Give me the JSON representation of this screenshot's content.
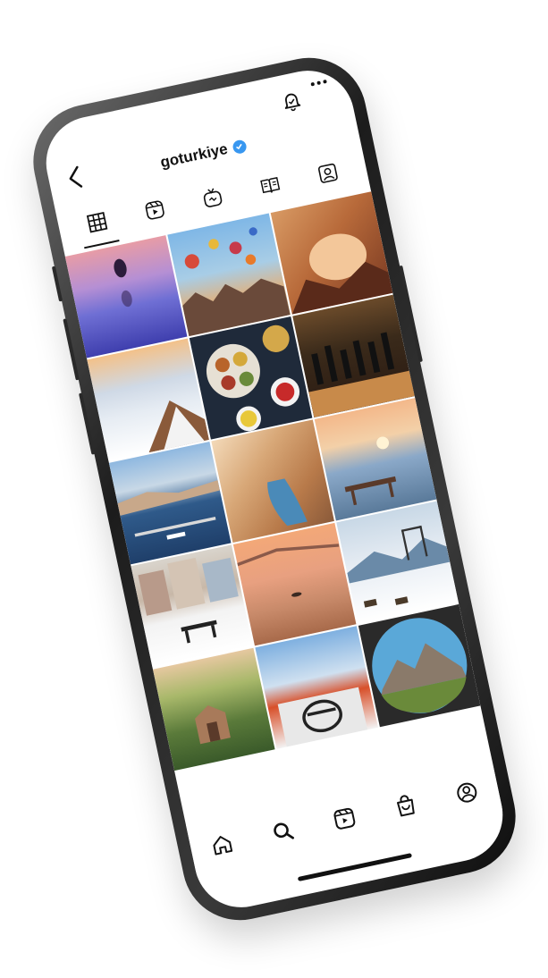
{
  "app": {
    "username": "goturkiye",
    "verified": true
  },
  "header": {
    "back_icon": "chevron-left-icon",
    "bell_icon": "notification-bell-icon",
    "more_icon": "more-horizontal-icon"
  },
  "profile_tabs": [
    {
      "name": "grid",
      "icon": "grid-icon",
      "active": true
    },
    {
      "name": "reels",
      "icon": "reels-icon",
      "active": false
    },
    {
      "name": "igtv",
      "icon": "igtv-icon",
      "active": false
    },
    {
      "name": "guides",
      "icon": "guides-icon",
      "active": false
    },
    {
      "name": "tagged",
      "icon": "tagged-icon",
      "active": false
    }
  ],
  "posts": [
    {
      "subject": "person-reflection-sunset"
    },
    {
      "subject": "hot-air-balloons-cappadocia"
    },
    {
      "subject": "rock-arch-canyon"
    },
    {
      "subject": "clouds-mountain-peak"
    },
    {
      "subject": "turkish-breakfast-plates"
    },
    {
      "subject": "orchestra-concert"
    },
    {
      "subject": "istanbul-bosphorus-aerial"
    },
    {
      "subject": "canyon-river"
    },
    {
      "subject": "sea-sunset-picnic-table"
    },
    {
      "subject": "snowy-street-bench"
    },
    {
      "subject": "lake-boat-sunset"
    },
    {
      "subject": "snowy-mountain-swing"
    },
    {
      "subject": "green-valley-ruins"
    },
    {
      "subject": "sky-building-mural"
    },
    {
      "subject": "mountain-fisheye"
    }
  ],
  "bottom_nav": [
    {
      "name": "home",
      "icon": "home-icon"
    },
    {
      "name": "search",
      "icon": "search-icon"
    },
    {
      "name": "reels",
      "icon": "reels-icon"
    },
    {
      "name": "shop",
      "icon": "shop-icon"
    },
    {
      "name": "profile",
      "icon": "profile-icon"
    }
  ],
  "colors": {
    "verified_blue": "#3897f0",
    "icon_dark": "#111111"
  }
}
